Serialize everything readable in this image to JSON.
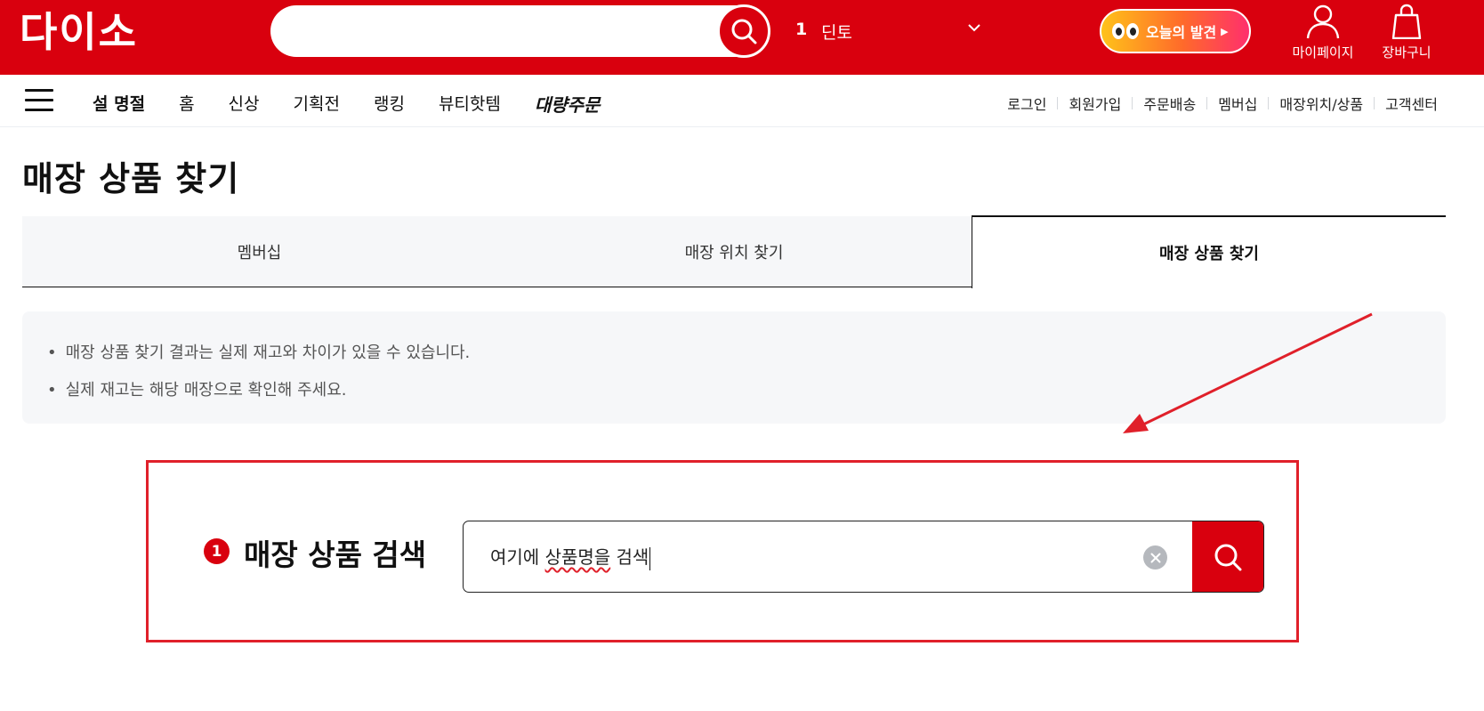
{
  "brand": {
    "logo_text": "다이소",
    "accent_color": "#d9000e"
  },
  "header": {
    "search_placeholder": "",
    "trending": {
      "rank": "1",
      "term": "딘토"
    },
    "discover_label": "오늘의 발견",
    "mypage_label": "마이페이지",
    "cart_label": "장바구니"
  },
  "nav": {
    "items": [
      "설 명절",
      "홈",
      "신상",
      "기획전",
      "랭킹",
      "뷰티핫템",
      "대량주문"
    ],
    "util_links": [
      "로그인",
      "회원가입",
      "주문배송",
      "멤버십",
      "매장위치/상품",
      "고객센터"
    ]
  },
  "page": {
    "title": "매장 상품 찾기",
    "tabs": [
      {
        "label": "멤버십",
        "active": false
      },
      {
        "label": "매장 위치 찾기",
        "active": false
      },
      {
        "label": "매장 상품 찾기",
        "active": true
      }
    ],
    "notices": [
      "매장 상품 찾기 결과는 실제 재고와 차이가 있을 수 있습니다.",
      "실제 재고는 해당 매장으로 확인해 주세요."
    ],
    "search": {
      "step": "1",
      "heading": "매장 상품 검색",
      "value_prefix": "여기에 ",
      "value_marked": "상품명을",
      "value_suffix": " 검색"
    }
  },
  "annotation": {
    "color": "#e0202a"
  }
}
